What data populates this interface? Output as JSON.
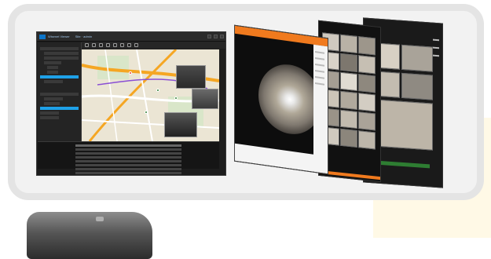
{
  "vms_window": {
    "title": "Wisenet Viewer",
    "menu_label": "Site · admin"
  },
  "accent_colors": {
    "brand_blue": "#0d75c9",
    "selection": "#1ea1e8",
    "orange_header": "#f07a1e"
  },
  "icons": [
    "map-pin-icon",
    "camera-icon",
    "settings-icon",
    "search-icon",
    "close-icon"
  ],
  "sidebar_rows": 14,
  "event_table_rows": 8
}
